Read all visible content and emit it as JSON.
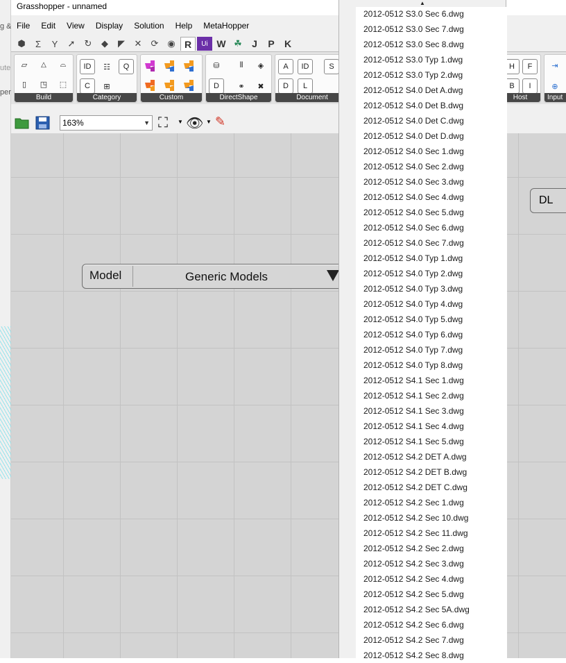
{
  "window": {
    "title": "Grasshopper - unnamed"
  },
  "background_cut": {
    "line1": "g &",
    "line2": "ute",
    "line3": "per"
  },
  "menu": [
    "File",
    "Edit",
    "View",
    "Display",
    "Solution",
    "Help",
    "MetaHopper"
  ],
  "tabs": {
    "icons": [
      "hexagon-icon",
      "sigma-icon",
      "vector-icon",
      "arrow-icon",
      "curve-icon",
      "surface-icon",
      "plane-icon",
      "intersect-icon",
      "transform-icon",
      "eye-icon"
    ],
    "letters": [
      "R",
      "Ui",
      "W",
      "J",
      "P",
      "K"
    ]
  },
  "ribbon": {
    "groups": [
      "Build",
      "Category",
      "Custom",
      "DirectShape",
      "Document",
      "Host",
      "Input"
    ],
    "category_buttons": [
      "ID",
      "Q",
      "C"
    ],
    "document_buttons": [
      "A",
      "ID",
      "S",
      "D",
      "L"
    ],
    "directshape_buttons": [
      "D"
    ],
    "host_buttons": [
      "H",
      "F",
      "B",
      "I"
    ]
  },
  "toolbar": {
    "zoom": "163%"
  },
  "canvas": {
    "component": {
      "label": "Model",
      "value": "Generic Models"
    },
    "dl_component": {
      "label": "DL"
    }
  },
  "dropdown": {
    "items": [
      "2012-0512 S3.0 Sec 6.dwg",
      "2012-0512 S3.0 Sec 7.dwg",
      "2012-0512 S3.0 Sec 8.dwg",
      "2012-0512 S3.0 Typ 1.dwg",
      "2012-0512 S3.0 Typ 2.dwg",
      "2012-0512 S4.0 Det A.dwg",
      "2012-0512 S4.0 Det B.dwg",
      "2012-0512 S4.0 Det C.dwg",
      "2012-0512 S4.0 Det D.dwg",
      "2012-0512 S4.0 Sec 1.dwg",
      "2012-0512 S4.0 Sec 2.dwg",
      "2012-0512 S4.0 Sec 3.dwg",
      "2012-0512 S4.0 Sec 4.dwg",
      "2012-0512 S4.0 Sec 5.dwg",
      "2012-0512 S4.0 Sec 6.dwg",
      "2012-0512 S4.0 Sec 7.dwg",
      "2012-0512 S4.0 Typ 1.dwg",
      "2012-0512 S4.0 Typ 2.dwg",
      "2012-0512 S4.0 Typ 3.dwg",
      "2012-0512 S4.0 Typ 4.dwg",
      "2012-0512 S4.0 Typ 5.dwg",
      "2012-0512 S4.0 Typ 6.dwg",
      "2012-0512 S4.0 Typ 7.dwg",
      "2012-0512 S4.0 Typ 8.dwg",
      "2012-0512 S4.1 Sec 1.dwg",
      "2012-0512 S4.1 Sec 2.dwg",
      "2012-0512 S4.1 Sec 3.dwg",
      "2012-0512 S4.1 Sec 4.dwg",
      "2012-0512 S4.1 Sec 5.dwg",
      "2012-0512 S4.2 DET A.dwg",
      "2012-0512 S4.2 DET B.dwg",
      "2012-0512 S4.2 DET C.dwg",
      "2012-0512 S4.2 Sec 1.dwg",
      "2012-0512 S4.2 Sec 10.dwg",
      "2012-0512 S4.2 Sec 11.dwg",
      "2012-0512 S4.2 Sec 2.dwg",
      "2012-0512 S4.2 Sec 3.dwg",
      "2012-0512 S4.2 Sec 4.dwg",
      "2012-0512 S4.2 Sec 5.dwg",
      "2012-0512 S4.2 Sec 5A.dwg",
      "2012-0512 S4.2 Sec 6.dwg",
      "2012-0512 S4.2 Sec 7.dwg",
      "2012-0512 S4.2 Sec 8.dwg"
    ]
  },
  "colors": {
    "python_orange": "#f39a1e",
    "python_magenta": "#d23ad1",
    "ui_purple": "#6b2fa8",
    "label_bar": "#474747"
  }
}
